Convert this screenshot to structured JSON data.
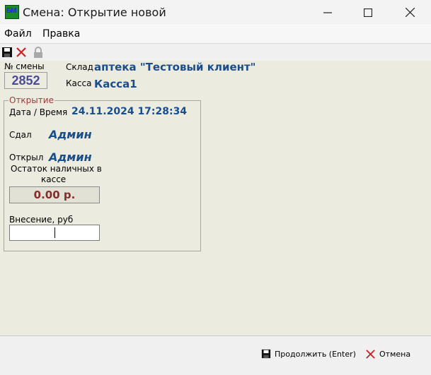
{
  "window": {
    "title": "Смена: Открытие новой",
    "icon_text": "БМ",
    "controls": [
      "minimize",
      "maximize",
      "close"
    ]
  },
  "menu": [
    {
      "label": "Файл"
    },
    {
      "label": "Правка"
    }
  ],
  "toolbar": {
    "icons": [
      "save-icon",
      "cancel-icon",
      "lock-icon"
    ]
  },
  "header": {
    "shift_label": "№ смены",
    "shift_number": "2852",
    "warehouse_label": "Склад",
    "warehouse_value": "аптека \"Тестовый клиент\"",
    "cashdesk_label": "Касса",
    "cashdesk_value": "Касса1"
  },
  "opening": {
    "legend": "Открытие",
    "datetime_label": "Дата / Время",
    "datetime_value": "24.11.2024 17:28:34",
    "handed_label": "Сдал",
    "handed_value": "Админ",
    "opened_label": "Открыл",
    "opened_value": "Админ",
    "cash_label_line1": "Остаток наличных в",
    "cash_label_line2": "кассе",
    "cash_value": "0.00 р.",
    "deposit_label": "Внесение, руб",
    "deposit_value": ""
  },
  "footer": {
    "continue_label": "Продолжить (Enter)",
    "cancel_label": "Отмена"
  },
  "colors": {
    "main_bg": "#ecebe0",
    "value_blue": "#1a4d8c",
    "cash_red": "#8a2a2a",
    "legend_red": "#a03a3a"
  }
}
